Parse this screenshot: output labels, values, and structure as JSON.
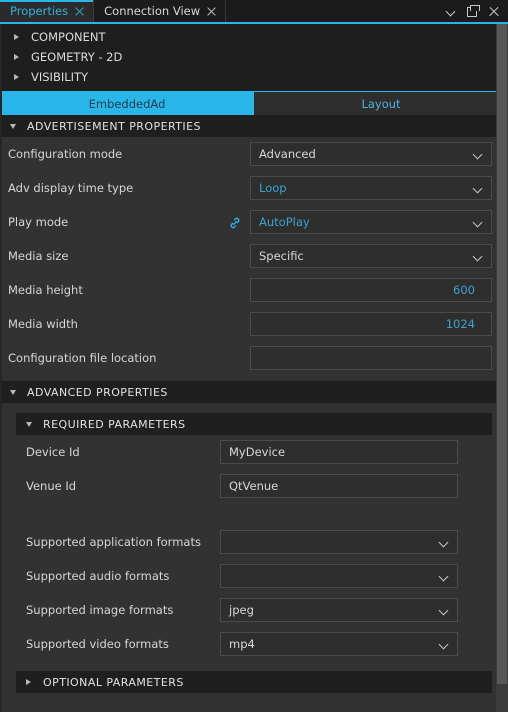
{
  "window": {
    "tabs": [
      {
        "label": "Properties",
        "active": true,
        "close_icon": "close-icon"
      },
      {
        "label": "Connection View",
        "active": false,
        "close_icon": "close-icon"
      }
    ],
    "controls": [
      {
        "name": "chevron-down-icon"
      },
      {
        "name": "float-window-icon"
      },
      {
        "name": "close-icon"
      }
    ],
    "accent_color": "#29b6e8"
  },
  "collapsed_sections": [
    {
      "label": "COMPONENT"
    },
    {
      "label": "GEOMETRY - 2D"
    },
    {
      "label": "VISIBILITY"
    }
  ],
  "subtabs": [
    {
      "label": "EmbeddedAd",
      "selected": true
    },
    {
      "label": "Layout",
      "selected": false
    }
  ],
  "advertisement_properties": {
    "header": "ADVERTISEMENT PROPERTIES",
    "expanded": true,
    "rows": [
      {
        "label": "Configuration mode",
        "value": "Advanced",
        "type": "dropdown",
        "value_style": "white"
      },
      {
        "label": "Adv display time type",
        "value": "Loop",
        "type": "dropdown",
        "value_style": "blue"
      },
      {
        "label": "Play mode",
        "value": "AutoPlay",
        "type": "dropdown",
        "value_style": "blue",
        "link_icon": "link-icon"
      },
      {
        "label": "Media size",
        "value": "Specific",
        "type": "dropdown",
        "value_style": "white"
      },
      {
        "label": "Media height",
        "value": "600",
        "type": "number",
        "value_style": "blue"
      },
      {
        "label": "Media width",
        "value": "1024",
        "type": "number",
        "value_style": "blue"
      },
      {
        "label": "Configuration file location",
        "value": "",
        "type": "text",
        "value_style": "white"
      }
    ]
  },
  "advanced_properties": {
    "header": "ADVANCED PROPERTIES",
    "expanded": true,
    "required_parameters": {
      "header": "REQUIRED PARAMETERS",
      "expanded": true,
      "rows": [
        {
          "label": "Device Id",
          "value": "MyDevice",
          "type": "text",
          "value_style": "white"
        },
        {
          "label": "Venue Id",
          "value": "QtVenue",
          "type": "text",
          "value_style": "white"
        },
        {
          "label": "Supported application formats",
          "value": "",
          "type": "dropdown",
          "value_style": "white"
        },
        {
          "label": "Supported audio formats",
          "value": "",
          "type": "dropdown",
          "value_style": "white"
        },
        {
          "label": "Supported image formats",
          "value": "jpeg",
          "type": "dropdown",
          "value_style": "white"
        },
        {
          "label": "Supported video formats",
          "value": "mp4",
          "type": "dropdown",
          "value_style": "white"
        }
      ]
    },
    "optional_parameters": {
      "header": "OPTIONAL PARAMETERS",
      "expanded": false
    }
  }
}
